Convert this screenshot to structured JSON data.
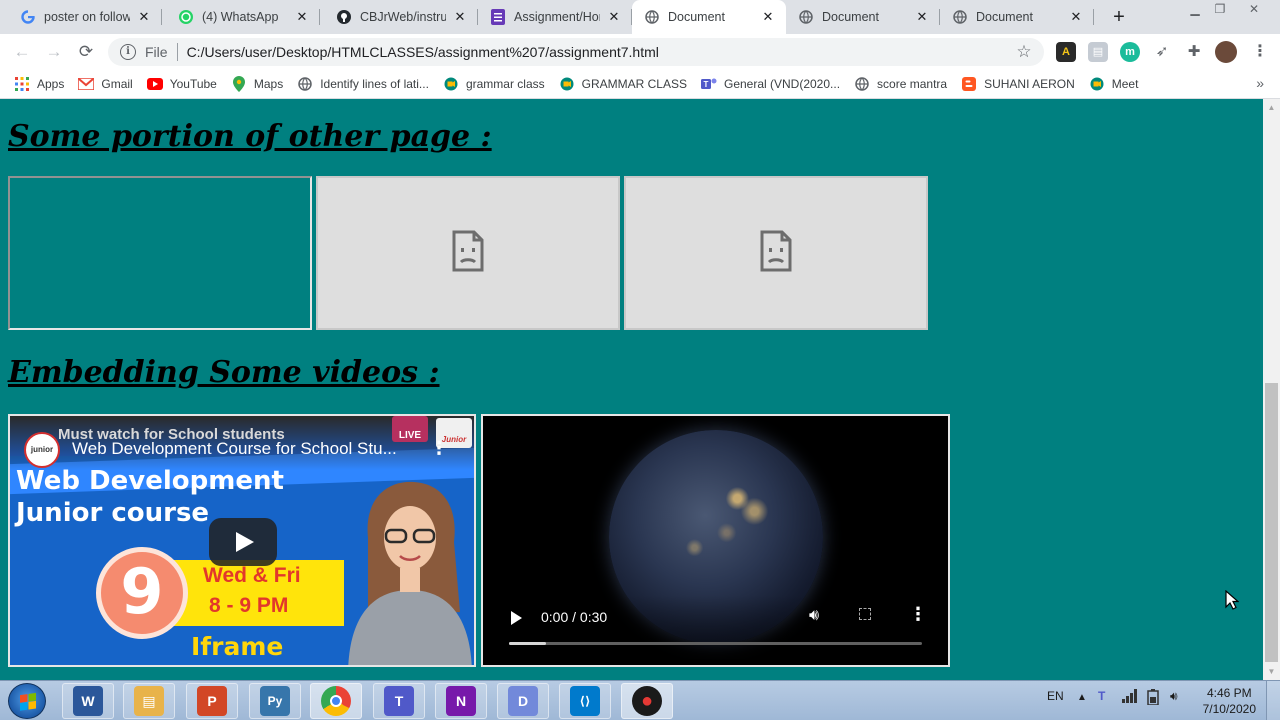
{
  "browser": {
    "tabs": [
      {
        "title": "poster on followi",
        "icon": "google-icon",
        "color": "#4285f4",
        "state": "inactive"
      },
      {
        "title": "(4) WhatsApp",
        "icon": "whatsapp-icon",
        "color": "#25d366",
        "state": "inactive"
      },
      {
        "title": "CBJrWeb/instruct",
        "icon": "github-icon",
        "color": "#24292e",
        "state": "inactive"
      },
      {
        "title": "Assignment/Hon",
        "icon": "forms-icon",
        "color": "#673ab7",
        "state": "inactive"
      },
      {
        "title": "Document",
        "icon": "globe-icon",
        "color": "#5f6368",
        "state": "active"
      },
      {
        "title": "Document",
        "icon": "globe-icon",
        "color": "#5f6368",
        "state": "inactive"
      },
      {
        "title": "Document",
        "icon": "globe-icon",
        "color": "#5f6368",
        "state": "inactive"
      }
    ],
    "omnibox": {
      "scheme_label": "File",
      "url": "C:/Users/user/Desktop/HTMLCLASSES/assignment%207/assignment7.html"
    },
    "bookmarks": [
      {
        "label": "Apps",
        "icon": "apps-grid-icon",
        "color": "#ea4335"
      },
      {
        "label": "Gmail",
        "icon": "gmail-icon",
        "color": "#ea4335"
      },
      {
        "label": "YouTube",
        "icon": "youtube-icon",
        "color": "#ff0000"
      },
      {
        "label": "Maps",
        "icon": "maps-pin-icon",
        "color": "#34a853"
      },
      {
        "label": "Identify lines of lati...",
        "icon": "globe-icon",
        "color": "#5f6368"
      },
      {
        "label": "grammar class",
        "icon": "meet-icon",
        "color": "#00897b"
      },
      {
        "label": "GRAMMAR CLASS",
        "icon": "meet-icon",
        "color": "#00897b"
      },
      {
        "label": "General (VND(2020...",
        "icon": "teams-icon",
        "color": "#5059c9"
      },
      {
        "label": "score mantra",
        "icon": "globe-icon",
        "color": "#5f6368"
      },
      {
        "label": "SUHANI AERON",
        "icon": "blogger-icon",
        "color": "#ff5722"
      },
      {
        "label": "Meet",
        "icon": "meet-icon",
        "color": "#00897b"
      }
    ],
    "extensions": [
      {
        "icon": "extension-a-icon",
        "color": "#2a2a2a"
      },
      {
        "icon": "extension-reader-icon",
        "color": "#c5cbd3"
      },
      {
        "icon": "extension-m-icon",
        "color": "#1bbc9b"
      },
      {
        "icon": "rocket-icon",
        "color": "#5f6368"
      },
      {
        "icon": "puzzle-icon",
        "color": "#5f6368"
      },
      {
        "icon": "profile-avatar-icon",
        "color": "#6b4a3a"
      }
    ]
  },
  "page": {
    "background": "#008080",
    "heading_frames": "Some portion of other page :",
    "heading_videos": "Embedding Some videos :",
    "youtube": {
      "channel_badge": "junior",
      "overlay_header": "Must watch for School students",
      "title": "Web Development Course for School Stu...",
      "live_badge": "LIVE",
      "brand_badge": "Junior",
      "line1": "Web Development",
      "line2": "Junior course",
      "number": "9",
      "days": "Wed & Fri",
      "time": "8 - 9 PM",
      "caption": "Iframe"
    },
    "video_player": {
      "time": "0:00 / 0:30",
      "progress_fraction": 0,
      "buffered_fraction": 0.09
    }
  },
  "taskbar": {
    "apps": [
      {
        "name": "word",
        "glyph": "W",
        "color": "#2b579a"
      },
      {
        "name": "explorer",
        "glyph": "▤",
        "color": "#e8b34a"
      },
      {
        "name": "powerpoint",
        "glyph": "P",
        "color": "#d24726"
      },
      {
        "name": "python",
        "glyph": "Py",
        "color": "#3776ab"
      },
      {
        "name": "chrome",
        "glyph": "●",
        "color": "#4285f4"
      },
      {
        "name": "teams",
        "glyph": "T",
        "color": "#5059c9"
      },
      {
        "name": "onenote",
        "glyph": "N",
        "color": "#7719aa"
      },
      {
        "name": "discord",
        "glyph": "D",
        "color": "#7289da"
      },
      {
        "name": "vscode",
        "glyph": "⟨⟩",
        "color": "#007acc"
      },
      {
        "name": "recorder",
        "glyph": "●",
        "color": "#1a1a1a"
      }
    ],
    "language": "EN",
    "time": "4:46 PM",
    "date": "7/10/2020"
  }
}
